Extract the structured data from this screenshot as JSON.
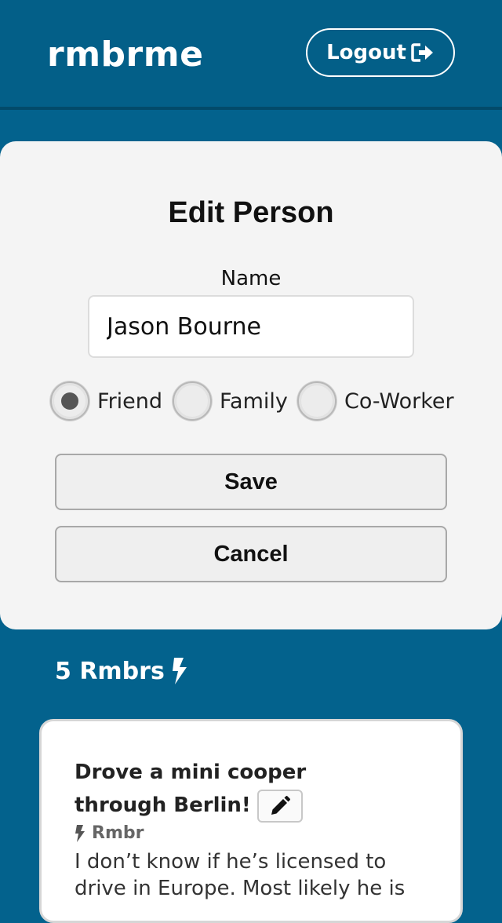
{
  "header": {
    "brand": "rmbrme",
    "logout_label": "Logout"
  },
  "form": {
    "title": "Edit Person",
    "name_label": "Name",
    "name_value": "Jason Bourne",
    "relationships": [
      {
        "label": "Friend",
        "selected": true
      },
      {
        "label": "Family",
        "selected": false
      },
      {
        "label": "Co-Worker",
        "selected": false
      }
    ],
    "save_label": "Save",
    "cancel_label": "Cancel"
  },
  "rmbrs": {
    "count_label": "5 Rmbrs",
    "items": [
      {
        "title": "Drove a mini cooper through Berlin!",
        "type": "Rmbr",
        "body": "I don’t know if he’s licensed to drive in Europe. Most likely he is"
      }
    ]
  },
  "colors": {
    "background": "#03628d",
    "header": "#035f88",
    "card": "#f4f4f4"
  }
}
